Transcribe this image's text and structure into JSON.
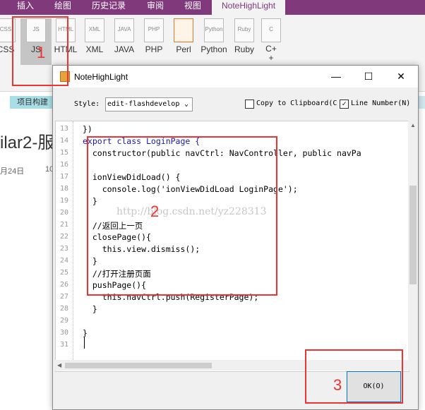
{
  "ribbon": {
    "tabs": [
      "插入",
      "绘图",
      "历史记录",
      "审阅",
      "视图",
      "NoteHighLight"
    ],
    "buttons": [
      {
        "label": "CSS",
        "icon": "css-icon"
      },
      {
        "label": "JS",
        "icon": "js-icon"
      },
      {
        "label": "HTML",
        "icon": "html-icon"
      },
      {
        "label": "XML",
        "icon": "xml-icon"
      },
      {
        "label": "JAVA",
        "icon": "java-icon"
      },
      {
        "label": "PHP",
        "icon": "php-icon"
      },
      {
        "label": "Perl",
        "icon": "perl-icon"
      },
      {
        "label": "Python",
        "icon": "python-icon"
      },
      {
        "label": "Ruby",
        "icon": "ruby-icon"
      },
      {
        "label": "C++",
        "icon": "cpp-icon"
      }
    ],
    "icon_texts": [
      "CSS",
      "JS",
      "HTML",
      "XML",
      "JAVA",
      "PHP",
      "",
      "Python",
      "Ruby",
      "C"
    ]
  },
  "page": {
    "tab_label": "项目构建",
    "title": "ilar2-服",
    "date": "月24日",
    "time": "10"
  },
  "dialog": {
    "title": "NoteHighLight",
    "style_label": "Style:",
    "style_value": "edit-flashdevelop",
    "copy_label": "Copy to Clipboard(C",
    "copy_checked": false,
    "line_number_label": "Line Number(N)",
    "line_number_checked": true,
    "ok_label": "OK(O)",
    "window_buttons": {
      "minimize": "—",
      "maximize": "☐",
      "close": "✕"
    }
  },
  "code": {
    "line_numbers": [
      "13",
      "14",
      "15",
      "16",
      "17",
      "18",
      "19",
      "20",
      "21",
      "22",
      "23",
      "24",
      "25",
      "26",
      "27",
      "28",
      "29",
      "30",
      "31"
    ],
    "lines": [
      "})",
      "export class LoginPage {",
      "  constructor(public navCtrl: NavController, public navPa",
      "",
      "  ionViewDidLoad() {",
      "    console.log('ionViewDidLoad LoginPage');",
      "  }",
      "",
      "  //返回上一页",
      "  closePage(){",
      "    this.view.dismiss();",
      "  }",
      "  //打开注册页面",
      "  pushPage(){",
      "    this.navCtrl.push(RegisterPage);",
      "  }",
      "",
      "}",
      ""
    ]
  },
  "watermark": "http://blog.csdn.net/yz228313",
  "annotations": [
    "1",
    "2",
    "3"
  ],
  "colors": {
    "ribbon": "#80397b",
    "annotation": "#e33333",
    "keyword": "#1a1aa6",
    "string": "#a31515"
  }
}
